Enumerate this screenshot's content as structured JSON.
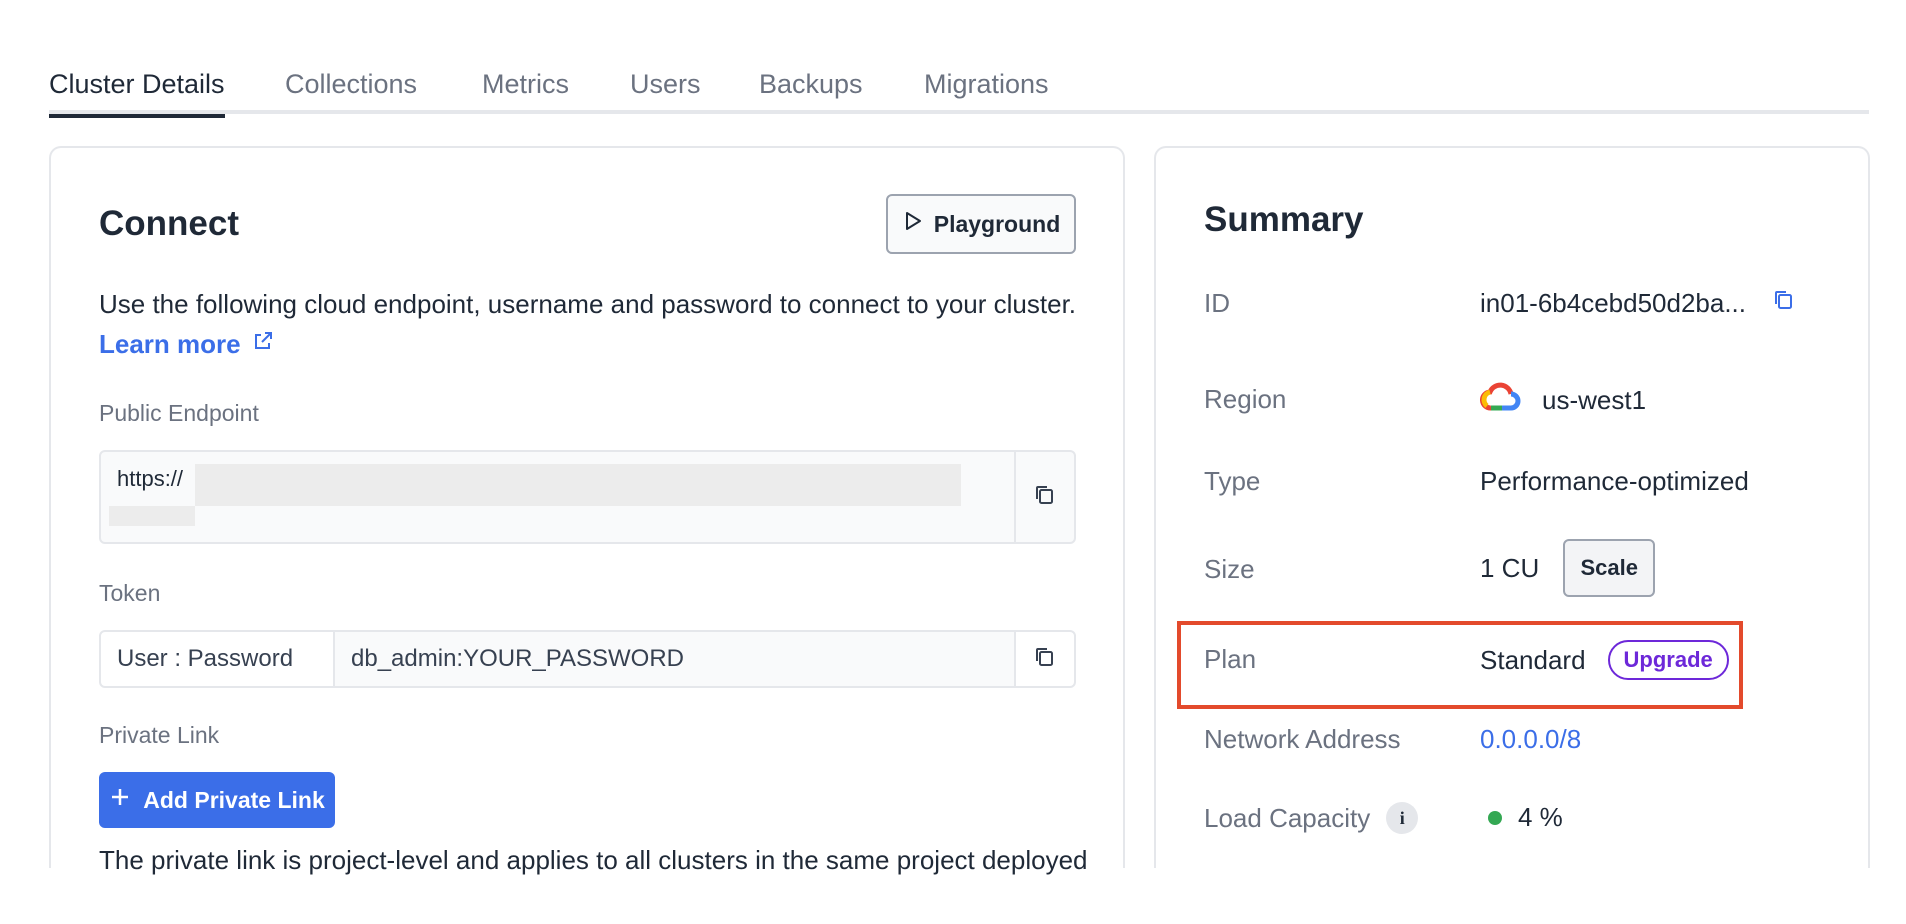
{
  "tabs": [
    {
      "label": "Cluster Details",
      "active": true
    },
    {
      "label": "Collections",
      "active": false
    },
    {
      "label": "Metrics",
      "active": false
    },
    {
      "label": "Users",
      "active": false
    },
    {
      "label": "Backups",
      "active": false
    },
    {
      "label": "Migrations",
      "active": false
    }
  ],
  "connect": {
    "title": "Connect",
    "playground_label": "Playground",
    "description": "Use the following cloud endpoint, username and password to connect to your cluster.",
    "learn_more": "Learn more",
    "public_endpoint_label": "Public Endpoint",
    "endpoint_value": "https://",
    "token_label": "Token",
    "token_key": "User : Password",
    "token_value": "db_admin:YOUR_PASSWORD",
    "private_link_label": "Private Link",
    "add_private_link": "Add Private Link",
    "private_link_note": "The private link is project-level and applies to all clusters in the same project deployed"
  },
  "summary": {
    "title": "Summary",
    "rows": {
      "id": {
        "label": "ID",
        "value": "in01-6b4cebd50d2ba..."
      },
      "region": {
        "label": "Region",
        "value": "us-west1"
      },
      "type": {
        "label": "Type",
        "value": "Performance-optimized"
      },
      "size": {
        "label": "Size",
        "value": "1 CU",
        "action": "Scale"
      },
      "plan": {
        "label": "Plan",
        "value": "Standard",
        "action": "Upgrade"
      },
      "network": {
        "label": "Network Address",
        "value": "0.0.0.0/8"
      },
      "load": {
        "label": "Load Capacity",
        "value": "4 %"
      }
    }
  },
  "colors": {
    "accent": "#3b6ee8",
    "upgrade": "#6d28d9",
    "highlight": "#e34a2c",
    "status_ok": "#34a853"
  }
}
